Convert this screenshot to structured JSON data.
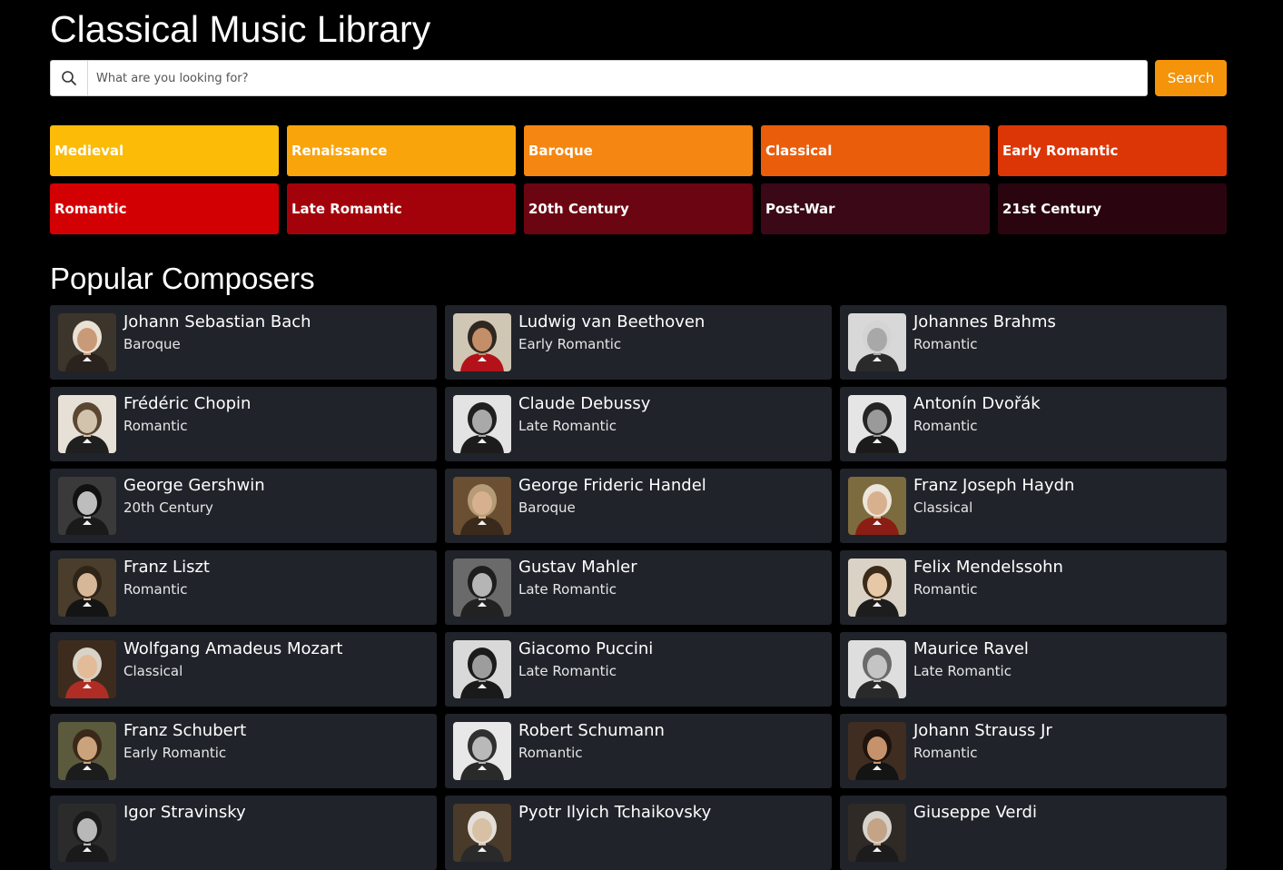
{
  "app": {
    "title": "Classical Music Library"
  },
  "search": {
    "placeholder": "What are you looking for?",
    "value": "",
    "button_label": "Search",
    "icon": "search-icon"
  },
  "eras": [
    {
      "slug": "medieval",
      "label": "Medieval",
      "color": "#fbbb07"
    },
    {
      "slug": "renaissance",
      "label": "Renaissance",
      "color": "#f9a40b"
    },
    {
      "slug": "baroque",
      "label": "Baroque",
      "color": "#f58611"
    },
    {
      "slug": "classical",
      "label": "Classical",
      "color": "#ea5d0b"
    },
    {
      "slug": "early-romantic",
      "label": "Early Romantic",
      "color": "#dc3607"
    },
    {
      "slug": "romantic",
      "label": "Romantic",
      "color": "#d30003"
    },
    {
      "slug": "late-romantic",
      "label": "Late Romantic",
      "color": "#a4020a"
    },
    {
      "slug": "20th-century",
      "label": "20th Century",
      "color": "#6c0512"
    },
    {
      "slug": "post-war",
      "label": "Post-War",
      "color": "#3b0818"
    },
    {
      "slug": "21st-century",
      "label": "21st Century",
      "color": "#2a0510"
    }
  ],
  "popular": {
    "heading": "Popular Composers",
    "composers": [
      {
        "slug": "bach",
        "name": "Johann Sebastian Bach",
        "era": "Baroque",
        "bg": "#3c352c",
        "skin": "#c99a78",
        "hair": "#e9e1d4",
        "coat": "#2a221c"
      },
      {
        "slug": "beethoven",
        "name": "Ludwig van Beethoven",
        "era": "Early Romantic",
        "bg": "#cfc6b4",
        "skin": "#c48e68",
        "hair": "#2f2720",
        "coat": "#b3121a"
      },
      {
        "slug": "brahms",
        "name": "Johannes Brahms",
        "era": "Romantic",
        "bg": "#d8d8d8",
        "skin": "#a8a8a8",
        "hair": "#d4d4d4",
        "coat": "#2a2a2a"
      },
      {
        "slug": "chopin",
        "name": "Frédéric Chopin",
        "era": "Romantic",
        "bg": "#e6e0d6",
        "skin": "#d2c3ad",
        "hair": "#5b4632",
        "coat": "#1f1f1f"
      },
      {
        "slug": "debussy",
        "name": "Claude Debussy",
        "era": "Late Romantic",
        "bg": "#e3e3e3",
        "skin": "#a9a9a9",
        "hair": "#1f1f1f",
        "coat": "#1c1c1c"
      },
      {
        "slug": "dvorak",
        "name": "Antonín Dvořák",
        "era": "Romantic",
        "bg": "#e5e5e5",
        "skin": "#9a9a9a",
        "hair": "#242424",
        "coat": "#1b1b1b"
      },
      {
        "slug": "gershwin",
        "name": "George Gershwin",
        "era": "20th Century",
        "bg": "#3a3a3a",
        "skin": "#bdbdbd",
        "hair": "#111111",
        "coat": "#1a1a1a"
      },
      {
        "slug": "handel",
        "name": "George Frideric Handel",
        "era": "Baroque",
        "bg": "#6b4f32",
        "skin": "#d7b08f",
        "hair": "#b69b77",
        "coat": "#3a2a1c"
      },
      {
        "slug": "haydn",
        "name": "Franz Joseph Haydn",
        "era": "Classical",
        "bg": "#7c6b3f",
        "skin": "#d9b08e",
        "hair": "#ebe5da",
        "coat": "#8a1d14"
      },
      {
        "slug": "liszt",
        "name": "Franz Liszt",
        "era": "Romantic",
        "bg": "#4a3d2b",
        "skin": "#d6b797",
        "hair": "#2f2418",
        "coat": "#141414"
      },
      {
        "slug": "mahler",
        "name": "Gustav Mahler",
        "era": "Late Romantic",
        "bg": "#6a6a6a",
        "skin": "#b5b5b5",
        "hair": "#1e1e1e",
        "coat": "#222222"
      },
      {
        "slug": "mendelssohn",
        "name": "Felix Mendelssohn",
        "era": "Romantic",
        "bg": "#d9d2c5",
        "skin": "#e6c8a6",
        "hair": "#3a2a1a",
        "coat": "#1d1d1d"
      },
      {
        "slug": "mozart",
        "name": "Wolfgang Amadeus Mozart",
        "era": "Classical",
        "bg": "#3d2c1e",
        "skin": "#e3bb98",
        "hair": "#d9d3c7",
        "coat": "#b02d25"
      },
      {
        "slug": "puccini",
        "name": "Giacomo Puccini",
        "era": "Late Romantic",
        "bg": "#d9d9d9",
        "skin": "#9d9d9d",
        "hair": "#1b1b1b",
        "coat": "#1a1a1a"
      },
      {
        "slug": "ravel",
        "name": "Maurice Ravel",
        "era": "Late Romantic",
        "bg": "#dedede",
        "skin": "#c4c4c4",
        "hair": "#6a6a6a",
        "coat": "#2a2a2a"
      },
      {
        "slug": "schubert",
        "name": "Franz Schubert",
        "era": "Early Romantic",
        "bg": "#5b5a3c",
        "skin": "#caa27c",
        "hair": "#3a2819",
        "coat": "#1c1c1c"
      },
      {
        "slug": "schumann",
        "name": "Robert Schumann",
        "era": "Romantic",
        "bg": "#e8e8e8",
        "skin": "#b9b9b9",
        "hair": "#303030",
        "coat": "#2a2a2a"
      },
      {
        "slug": "strauss",
        "name": "Johann Strauss Jr",
        "era": "Romantic",
        "bg": "#3f2d22",
        "skin": "#c5926c",
        "hair": "#1e130d",
        "coat": "#141414"
      },
      {
        "slug": "stravinsky",
        "name": "Igor Stravinsky",
        "era": "",
        "bg": "#2b2b2b",
        "skin": "#b8b8b8",
        "hair": "#1a1a1a",
        "coat": "#1a1a1a"
      },
      {
        "slug": "tchaikovsky",
        "name": "Pyotr Ilyich Tchaikovsky",
        "era": "",
        "bg": "#4a3a2a",
        "skin": "#d8c0a4",
        "hair": "#e3dfd8",
        "coat": "#2a2a2a"
      },
      {
        "slug": "verdi",
        "name": "Giuseppe Verdi",
        "era": "",
        "bg": "#2f2a26",
        "skin": "#c4a387",
        "hair": "#d6d2cb",
        "coat": "#1c1c1c"
      }
    ]
  }
}
